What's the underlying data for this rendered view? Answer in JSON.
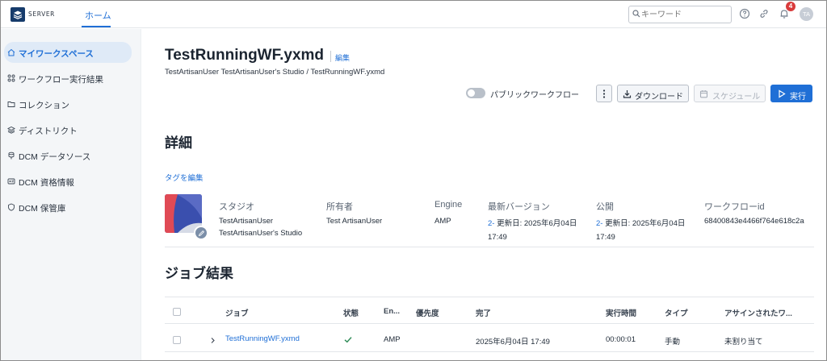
{
  "topbar": {
    "logo_text": "SERVER",
    "nav_home": "ホーム",
    "search_placeholder": "キーワード",
    "notification_count": "4",
    "avatar_initials": "TA"
  },
  "sidebar": {
    "items": [
      {
        "label": "マイワークスペース",
        "icon": "home-icon",
        "active": true
      },
      {
        "label": "ワークフロー実行結果",
        "icon": "workflow-results-icon",
        "active": false
      },
      {
        "label": "コレクション",
        "icon": "folder-icon",
        "active": false
      },
      {
        "label": "ディストリクト",
        "icon": "layers-icon",
        "active": false
      },
      {
        "label": "DCM データソース",
        "icon": "datasource-icon",
        "active": false
      },
      {
        "label": "DCM 資格情報",
        "icon": "credentials-icon",
        "active": false
      },
      {
        "label": "DCM 保管庫",
        "icon": "vault-icon",
        "active": false
      }
    ]
  },
  "header": {
    "title": "TestRunningWF.yxmd",
    "edit_label": "編集",
    "breadcrumb": "TestArtisanUser TestArtisanUser's Studio / TestRunningWF.yxmd"
  },
  "actions": {
    "public_toggle_label": "パブリックワークフロー",
    "public_toggle_on": false,
    "download_label": "ダウンロード",
    "schedule_label": "スケジュール",
    "run_label": "実行"
  },
  "details": {
    "heading": "詳細",
    "tag_edit_label": "タグを編集",
    "columns": {
      "studio": {
        "header": "スタジオ",
        "line1": "TestArtisanUser",
        "line2": "TestArtisanUser's Studio"
      },
      "owner": {
        "header": "所有者",
        "value": "Test ArtisanUser"
      },
      "engine": {
        "header": "Engine",
        "value": "AMP"
      },
      "latest_version": {
        "header": "最新バージョン",
        "version": "2-",
        "line1": " 更新日: 2025年6月04日",
        "line2": "17:49"
      },
      "published": {
        "header": "公開",
        "version": "2-",
        "line1": " 更新日: 2025年6月04日",
        "line2": "17:49"
      },
      "workflow_id": {
        "header": "ワークフローid",
        "value": "68400843e4466f764e618c2a"
      }
    }
  },
  "jobs": {
    "heading": "ジョブ結果",
    "headers": [
      "ジョブ",
      "状態",
      "En...",
      "優先度",
      "完了",
      "実行時間",
      "タイプ",
      "アサインされたワ..."
    ],
    "rows": [
      {
        "job": "TestRunningWF.yxmd",
        "status_icon": "check-icon",
        "engine": "AMP",
        "priority": "",
        "completed": "2025年6月04日 17:49",
        "duration": "00:00:01",
        "type": "手動",
        "assigned": "未割り当て"
      }
    ]
  },
  "colors": {
    "accent": "#1f6fd6",
    "sidebar_active_bg": "#dfeaf7",
    "badge": "#d93b3b",
    "success": "#2e8b57"
  }
}
